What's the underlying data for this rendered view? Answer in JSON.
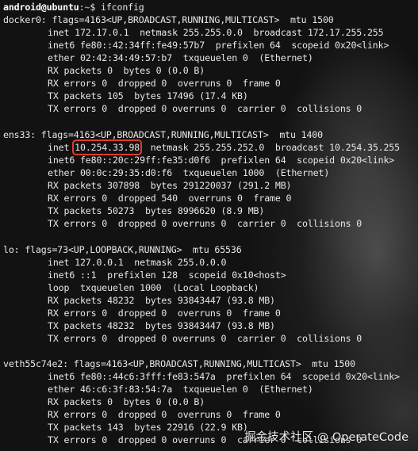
{
  "prompt": {
    "user_host": "android@ubuntu",
    "separator": ":",
    "path": "~",
    "symbol": "$",
    "command": "ifconfig"
  },
  "interfaces": [
    {
      "id": "docker0",
      "header": "docker0: flags=4163<UP,BROADCAST,RUNNING,MULTICAST>  mtu 1500",
      "lines": [
        "inet 172.17.0.1  netmask 255.255.0.0  broadcast 172.17.255.255",
        "inet6 fe80::42:34ff:fe49:57b7  prefixlen 64  scopeid 0x20<link>",
        "ether 02:42:34:49:57:b7  txqueuelen 0  (Ethernet)",
        "RX packets 0  bytes 0 (0.0 B)",
        "RX errors 0  dropped 0  overruns 0  frame 0",
        "TX packets 105  bytes 17496 (17.4 KB)",
        "TX errors 0  dropped 0 overruns 0  carrier 0  collisions 0"
      ]
    },
    {
      "id": "ens33",
      "header": "ens33: flags=4163<UP,BROADCAST,RUNNING,MULTICAST>  mtu 1400",
      "inet_prefix": "inet ",
      "inet_address": "10.254.33.98",
      "inet_suffix": "  netmask 255.255.252.0  broadcast 10.254.35.255",
      "lines": [
        "inet6 fe80::20c:29ff:fe35:d0f6  prefixlen 64  scopeid 0x20<link>",
        "ether 00:0c:29:35:d0:f6  txqueuelen 1000  (Ethernet)",
        "RX packets 307898  bytes 291220037 (291.2 MB)",
        "RX errors 0  dropped 540  overruns 0  frame 0",
        "TX packets 50273  bytes 8996620 (8.9 MB)",
        "TX errors 0  dropped 0 overruns 0  carrier 0  collisions 0"
      ]
    },
    {
      "id": "lo",
      "header": "lo: flags=73<UP,LOOPBACK,RUNNING>  mtu 65536",
      "lines": [
        "inet 127.0.0.1  netmask 255.0.0.0",
        "inet6 ::1  prefixlen 128  scopeid 0x10<host>",
        "loop  txqueuelen 1000  (Local Loopback)",
        "RX packets 48232  bytes 93843447 (93.8 MB)",
        "RX errors 0  dropped 0  overruns 0  frame 0",
        "TX packets 48232  bytes 93843447 (93.8 MB)",
        "TX errors 0  dropped 0 overruns 0  carrier 0  collisions 0"
      ]
    },
    {
      "id": "veth55c74e2",
      "header": "veth55c74e2: flags=4163<UP,BROADCAST,RUNNING,MULTICAST>  mtu 1500",
      "lines": [
        "inet6 fe80::44c6:3fff:fe83:547a  prefixlen 64  scopeid 0x20<link>",
        "ether 46:c6:3f:83:54:7a  txqueuelen 0  (Ethernet)",
        "RX packets 0  bytes 0 (0.0 B)",
        "RX errors 0  dropped 0  overruns 0  frame 0",
        "TX packets 143  bytes 22916 (22.9 KB)",
        "TX errors 0  dropped 0 overruns 0  carrier 0  collisions 0"
      ]
    }
  ],
  "watermark": "掘金技术社区 @ OperateCode",
  "colors": {
    "background": "#121212",
    "text": "#e8e8e8",
    "path": "#6ea0ff",
    "highlight_box": "#e23a2a"
  }
}
